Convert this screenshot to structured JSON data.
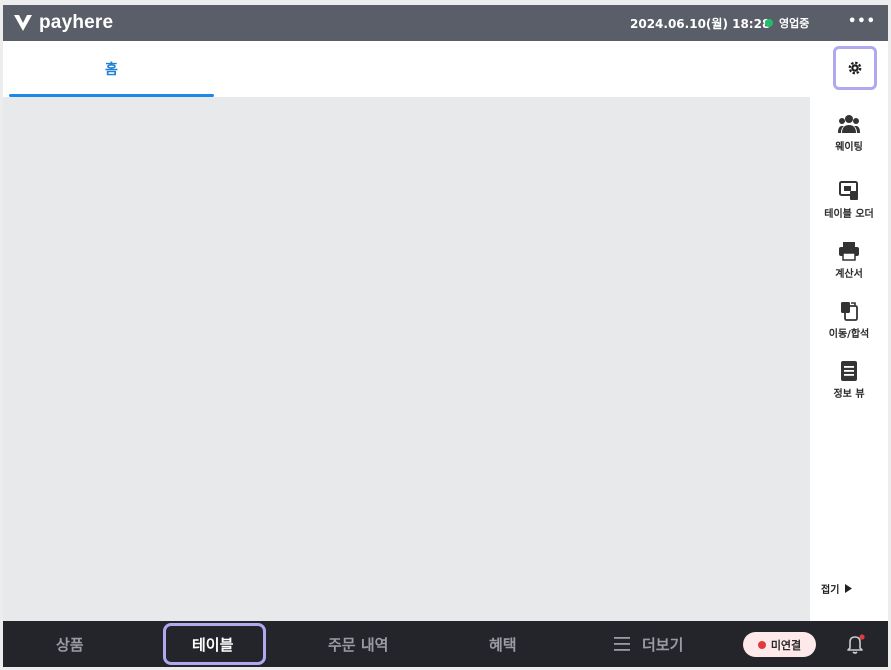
{
  "brand": {
    "name": "payhere"
  },
  "header": {
    "datetime": "2024.06.10(월) 18:28",
    "status_label": "영업중",
    "status_color": "#1fbf6a",
    "more_label": "•••"
  },
  "tabs": [
    {
      "label": "홈",
      "active": true
    }
  ],
  "sidebar": {
    "items": [
      {
        "label": "웨이팅",
        "icon": "people-icon"
      },
      {
        "label": "테이블 오더",
        "icon": "table-order-icon"
      },
      {
        "label": "계산서",
        "icon": "printer-icon"
      },
      {
        "label": "이동/합석",
        "icon": "move-merge-icon"
      },
      {
        "label": "정보 뷰",
        "icon": "document-icon"
      }
    ],
    "settings_icon": "gear-icon",
    "fold_label": "접기"
  },
  "bottom_nav": {
    "items": [
      {
        "label": "상품",
        "active": false
      },
      {
        "label": "테이블",
        "active": true
      },
      {
        "label": "주문 내역",
        "active": false
      },
      {
        "label": "혜택",
        "active": false
      },
      {
        "label": "더보기",
        "active": false,
        "icon": "menu-icon"
      }
    ],
    "connection_label": "미연결",
    "connection_color": "#e23b3b",
    "bell_icon": "bell-icon"
  },
  "colors": {
    "accent": "#1e88e5",
    "topbar": "#5a5e68",
    "bottombar": "#23252b",
    "highlight": "#b1a9f0"
  }
}
